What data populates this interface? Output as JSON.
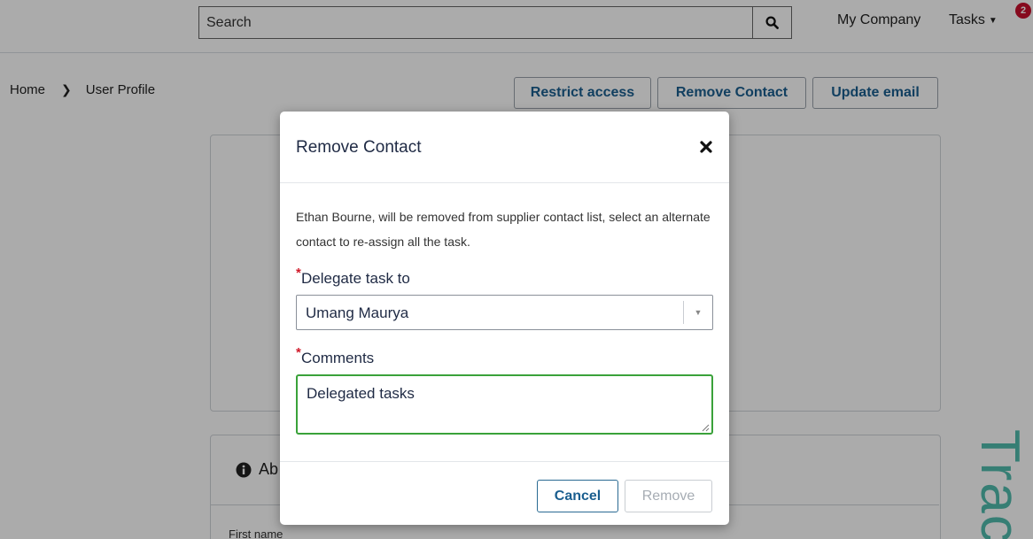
{
  "header": {
    "search_placeholder": "Search",
    "search_icon": "search-icon",
    "company": "My Company",
    "tasks_label": "Tasks",
    "tasks_badge": "2"
  },
  "breadcrumb": {
    "home": "Home",
    "current": "User Profile"
  },
  "actions": {
    "restrict": "Restrict access",
    "remove_contact": "Remove Contact",
    "update_email": "Update email"
  },
  "about_section": {
    "title": "Ab",
    "first_name_label": "First name"
  },
  "watermark": "Trac",
  "modal": {
    "title": "Remove Contact",
    "close_icon": "close-icon",
    "message": "Ethan Bourne, will be removed from supplier contact list, select an alternate contact to re-assign all the task.",
    "delegate_label": "Delegate task to",
    "delegate_value": "Umang Maurya",
    "comments_label": "Comments",
    "comments_value": "Delegated tasks",
    "required_mark": "*",
    "cancel": "Cancel",
    "remove": "Remove"
  },
  "colors": {
    "accent": "#1a5e8f",
    "badge": "#c8102e",
    "focus_border": "#3aa23a",
    "required": "#d11a2a"
  }
}
